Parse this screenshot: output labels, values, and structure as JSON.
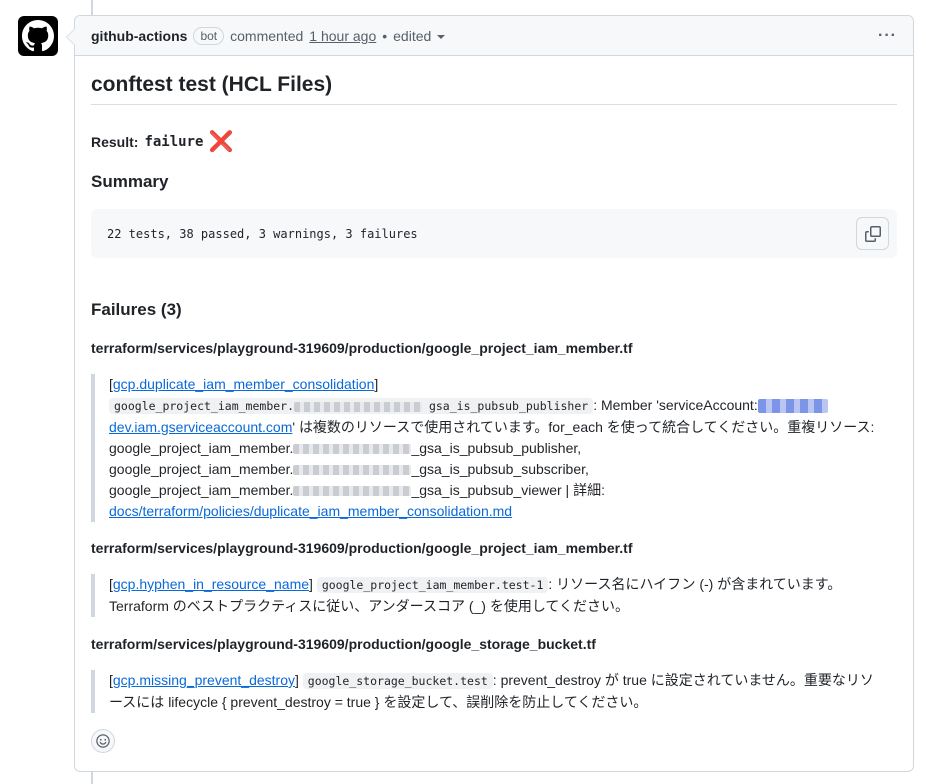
{
  "comment": {
    "author": "github-actions",
    "badge": "bot",
    "action": "commented",
    "time_ago": "1 hour ago",
    "separator": "•",
    "edited_label": "edited",
    "menu_label": "···"
  },
  "body": {
    "title": "conftest test (HCL Files)",
    "result_label": "Result:",
    "result_value": "failure",
    "result_icon": "❌",
    "summary_heading": "Summary",
    "summary_text": "22 tests, 38 passed, 3 warnings, 3 failures",
    "failures_heading": "Failures (3)",
    "failures": [
      {
        "file": "terraform/services/playground-319609/production/google_project_iam_member.tf",
        "rule": "gcp.duplicate_iam_member_consolidation",
        "resource_prefix": "google_project_iam_member.",
        "resource_suffix": "gsa_is_pubsub_publisher",
        "msg_part1": ": Member 'serviceAccount:",
        "link2": "dev.iam.gserviceaccount.com",
        "msg_part2": "' は複数のリソースで使用されています。for_each を使って統合してください。重複リソース:",
        "dup_prefix": "google_project_iam_member.",
        "dup1_suffix": "_gsa_is_pubsub_publisher,",
        "dup2_suffix": "_gsa_is_pubsub_subscriber,",
        "dup3_suffix": "_gsa_is_pubsub_viewer | 詳細:",
        "doc_link": "docs/terraform/policies/duplicate_iam_member_consolidation.md"
      },
      {
        "file": "terraform/services/playground-319609/production/google_project_iam_member.tf",
        "rule": "gcp.hyphen_in_resource_name",
        "resource": "google_project_iam_member.test-1",
        "msg_line1": ": リソース名にハイフン (-) が含まれています。",
        "msg_line2": "Terraform のベストプラクティスに従い、アンダースコア (_) を使用してください。"
      },
      {
        "file": "terraform/services/playground-319609/production/google_storage_bucket.tf",
        "rule": "gcp.missing_prevent_destroy",
        "resource": "google_storage_bucket.test",
        "msg_line1": ": prevent_destroy が true に設定されていません。重要なリソ",
        "msg_line2": "ースには lifecycle { prevent_destroy = true } を設定して、誤削除を防止してください。"
      }
    ]
  },
  "icons": {
    "avatar": "github-logo-icon",
    "copy": "copy-icon",
    "reaction": "smiley-icon"
  },
  "colors": {
    "link": "#0969da",
    "border": "#d0d7de",
    "header_bg": "#f6f8fa",
    "failure_icon": "#e53935"
  }
}
